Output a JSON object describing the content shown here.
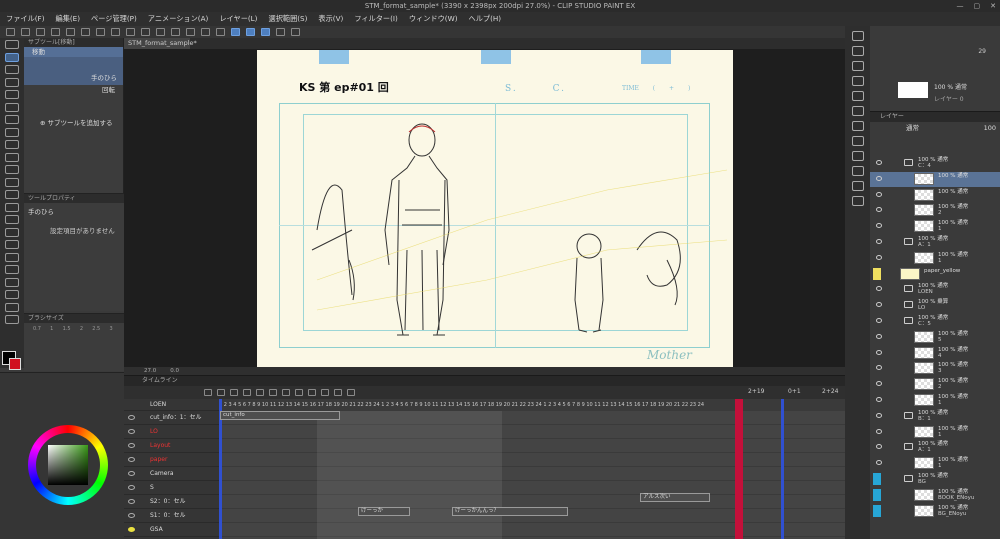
{
  "window": {
    "title": "STM_format_sample* (3390 x 2398px 200dpi 27.0%)  - CLIP STUDIO PAINT EX"
  },
  "menu": [
    "ファイル(F)",
    "編集(E)",
    "ページ管理(P)",
    "アニメーション(A)",
    "レイヤー(L)",
    "選択範囲(S)",
    "表示(V)",
    "フィルター(I)",
    "ウィンドウ(W)",
    "ヘルプ(H)"
  ],
  "subtool": {
    "header": "サブツール[移動]",
    "group": "移動",
    "selected": "手のひら",
    "rotate": "回転",
    "add_label": "サブツールを追加する"
  },
  "tool_property": {
    "header": "ツールプロパティ",
    "name": "手のひら",
    "empty_msg": "設定項目がありません"
  },
  "brush_size": {
    "header": "ブラシサイズ",
    "sizes": [
      "0.7",
      "1",
      "1.5",
      "2",
      "2.5",
      "3"
    ]
  },
  "document": {
    "tab": "STM_format_sample*",
    "header_tag": "KS 第 ep#01 回",
    "sc_tag": "S. C.",
    "time_tag": "TIME ( + )",
    "logo": "Mother",
    "zoom": "27.0",
    "angle": "0.0"
  },
  "timeline": {
    "header": "タイムライン",
    "timeline_name": "LOEN",
    "frame_readout": "2+19",
    "frame_readout2": "0+1",
    "frame_total": "2+24",
    "current_frame": "2+19",
    "ruler": "1 2 3 4 5 6 7 8 9 10 11 12 13 14 15 16 17 18 19 20 21 22 23 24 1 2 3 4 5 6 7 8 9 10 11 12 13 14 15 16 17 18 19 20 21 22 23 24 1 2 3 4 5 6 7 8 9 10 11 12 13 14 15 16 17 18 19 20 21 22 23 24",
    "tracks": [
      {
        "name": "cut_info：1：セル",
        "red": false
      },
      {
        "name": "LO",
        "red": true
      },
      {
        "name": "Layout",
        "red": true
      },
      {
        "name": "paper",
        "red": true
      },
      {
        "name": "Camera",
        "red": false
      },
      {
        "name": "S",
        "red": false
      },
      {
        "name": "S2：0：セル",
        "red": false
      },
      {
        "name": "S1：0：セル",
        "red": false
      },
      {
        "name": "GSA",
        "red": false
      }
    ],
    "clips": {
      "cut_info": "cut_info",
      "s1_a": "けーっか",
      "s1_b": "けーっかんんっ？",
      "s2": "アルス次い"
    }
  },
  "navigator": {
    "zoom": "29",
    "layer_label": "100 % 通常",
    "layer_sub": "レイヤー 0"
  },
  "layer_panel": {
    "header": "レイヤー",
    "mode": "通常",
    "opacity": "100",
    "layers": [
      {
        "n1": "100 % 通常",
        "n2": "C：4",
        "kind": "folder"
      },
      {
        "n1": "100 % 通常",
        "n2": "",
        "kind": "thumb",
        "sel": true
      },
      {
        "n1": "100 % 通常",
        "n2": "",
        "kind": "thumb"
      },
      {
        "n1": "100 % 通常",
        "n2": "2",
        "kind": "thumb"
      },
      {
        "n1": "100 % 通常",
        "n2": "1",
        "kind": "thumb"
      },
      {
        "n1": "100 % 通常",
        "n2": "A：1",
        "kind": "folder"
      },
      {
        "n1": "100 % 通常",
        "n2": "1",
        "kind": "thumb"
      },
      {
        "n1": "paper_yellow",
        "n2": "",
        "kind": "paper"
      },
      {
        "n1": "100 % 通常",
        "n2": "LOEN",
        "kind": "folder"
      },
      {
        "n1": "100 % 乗算",
        "n2": "LO",
        "kind": "folder"
      },
      {
        "n1": "100 % 通常",
        "n2": "C：5",
        "kind": "folder"
      },
      {
        "n1": "100 % 通常",
        "n2": "5",
        "kind": "thumb"
      },
      {
        "n1": "100 % 通常",
        "n2": "4",
        "kind": "thumb"
      },
      {
        "n1": "100 % 通常",
        "n2": "3",
        "kind": "thumb"
      },
      {
        "n1": "100 % 通常",
        "n2": "2",
        "kind": "thumb"
      },
      {
        "n1": "100 % 通常",
        "n2": "1",
        "kind": "thumb"
      },
      {
        "n1": "100 % 通常",
        "n2": "B：1",
        "kind": "folder"
      },
      {
        "n1": "100 % 通常",
        "n2": "1",
        "kind": "thumb"
      },
      {
        "n1": "100 % 通常",
        "n2": "A：1",
        "kind": "folder"
      },
      {
        "n1": "100 % 通常",
        "n2": "1",
        "kind": "thumb"
      },
      {
        "n1": "100 % 通常",
        "n2": "BG",
        "kind": "folder"
      },
      {
        "n1": "100 % 通常",
        "n2": "BOOK_ENoyu",
        "kind": "thumb"
      },
      {
        "n1": "100 % 通常",
        "n2": "BG_ENoyu",
        "kind": "thumb"
      }
    ]
  },
  "colors": {
    "foreground": "#000000",
    "background": "#d01020",
    "accent": "#4e7fbf",
    "timeline_playhead": "#c4103a"
  }
}
